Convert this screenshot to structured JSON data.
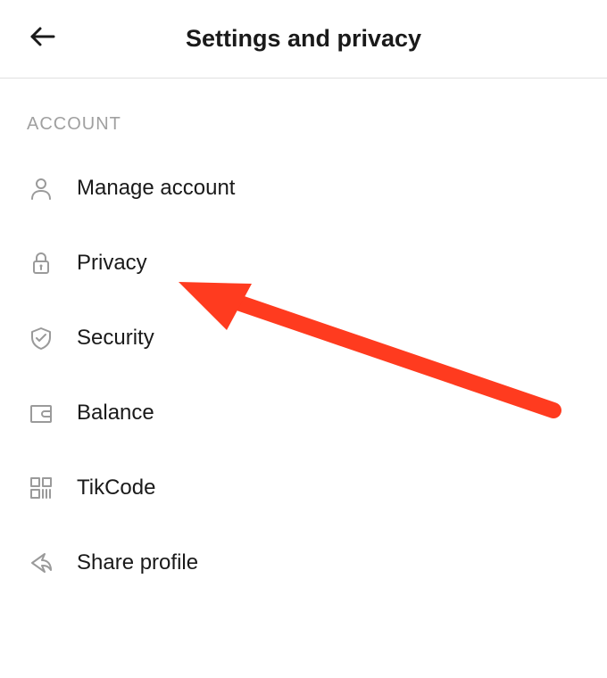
{
  "header": {
    "title": "Settings and privacy"
  },
  "section": {
    "account_label": "ACCOUNT"
  },
  "menu": {
    "items": [
      {
        "icon": "person-icon",
        "label": "Manage account"
      },
      {
        "icon": "lock-icon",
        "label": "Privacy"
      },
      {
        "icon": "shield-icon",
        "label": "Security"
      },
      {
        "icon": "wallet-icon",
        "label": "Balance"
      },
      {
        "icon": "tikcode-icon",
        "label": "TikCode"
      },
      {
        "icon": "share-icon",
        "label": "Share profile"
      }
    ]
  },
  "annotation": {
    "arrow_color": "#ff3b1f",
    "points_to": "privacy"
  }
}
